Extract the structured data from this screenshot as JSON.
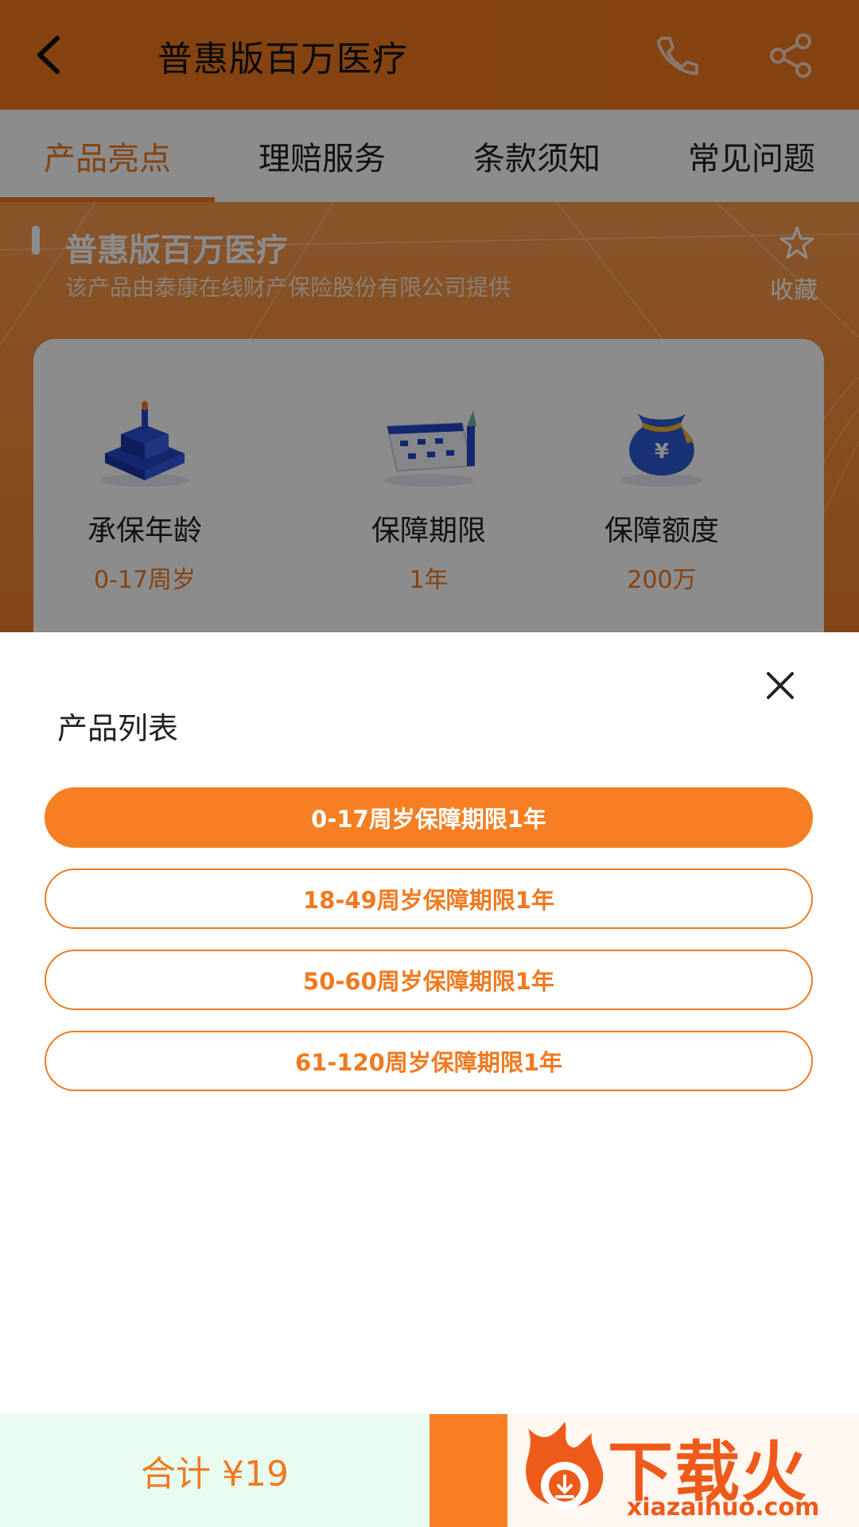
{
  "header": {
    "title": "普惠版百万医疗"
  },
  "tabs": [
    {
      "label": "产品亮点",
      "active": true
    },
    {
      "label": "理赔服务"
    },
    {
      "label": "条款须知"
    },
    {
      "label": "常见问题"
    }
  ],
  "hero": {
    "title": "普惠版百万医疗",
    "subtitle": "该产品由泰康在线财产保险股份有限公司提供",
    "favorite_label": "收藏"
  },
  "features": [
    {
      "icon": "cake-icon",
      "name": "承保年龄",
      "value": "0-17周岁"
    },
    {
      "icon": "calendar-icon",
      "name": "保障期限",
      "value": "1年"
    },
    {
      "icon": "money-bag-icon",
      "name": "保障额度",
      "value": "200万"
    }
  ],
  "sheet": {
    "title": "产品列表",
    "options": [
      {
        "label": "0-17周岁保障期限1年",
        "selected": true
      },
      {
        "label": "18-49周岁保障期限1年"
      },
      {
        "label": "50-60周岁保障期限1年"
      },
      {
        "label": "61-120周岁保障期限1年"
      }
    ]
  },
  "footer": {
    "total_label": "合计 ¥19"
  },
  "watermark": {
    "brand": "下载火",
    "url": "xiazaihuo.com"
  },
  "colors": {
    "accent": "#f07a20",
    "accent_button": "#f57f22",
    "footer_bg": "#e8fbef"
  }
}
